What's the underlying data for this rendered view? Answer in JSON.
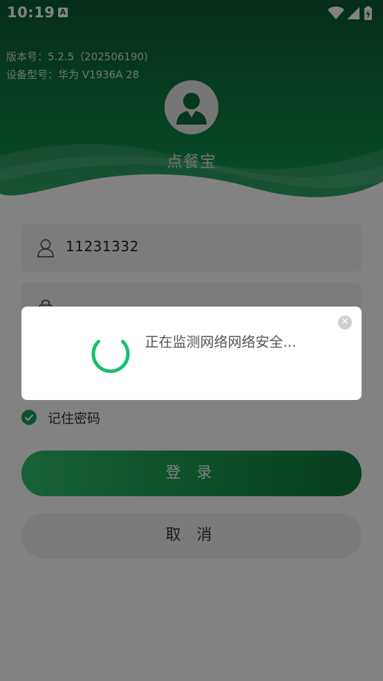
{
  "status_bar": {
    "time": "10:19",
    "notification_icon": "A",
    "icons": [
      "wifi-icon",
      "signal-icon",
      "battery-charging-icon"
    ]
  },
  "header": {
    "version_label": "版本号：5.2.5（202506190)",
    "device_label": "设备型号：华为 V1936A 28",
    "app_title": "点餐宝"
  },
  "login_form": {
    "username_value": "11231332",
    "remember_label": "记住密码",
    "remember_checked": true,
    "login_button": "登 录",
    "cancel_button": "取 消"
  },
  "loading_dialog": {
    "message": "正在监测网络网络安全...",
    "spinner_icon": "loading-spinner-icon",
    "close_icon": "close-icon"
  },
  "colors": {
    "brand_dark": "#0a5a32",
    "brand_green": "#1a9a52",
    "spinner": "#16c06a"
  }
}
